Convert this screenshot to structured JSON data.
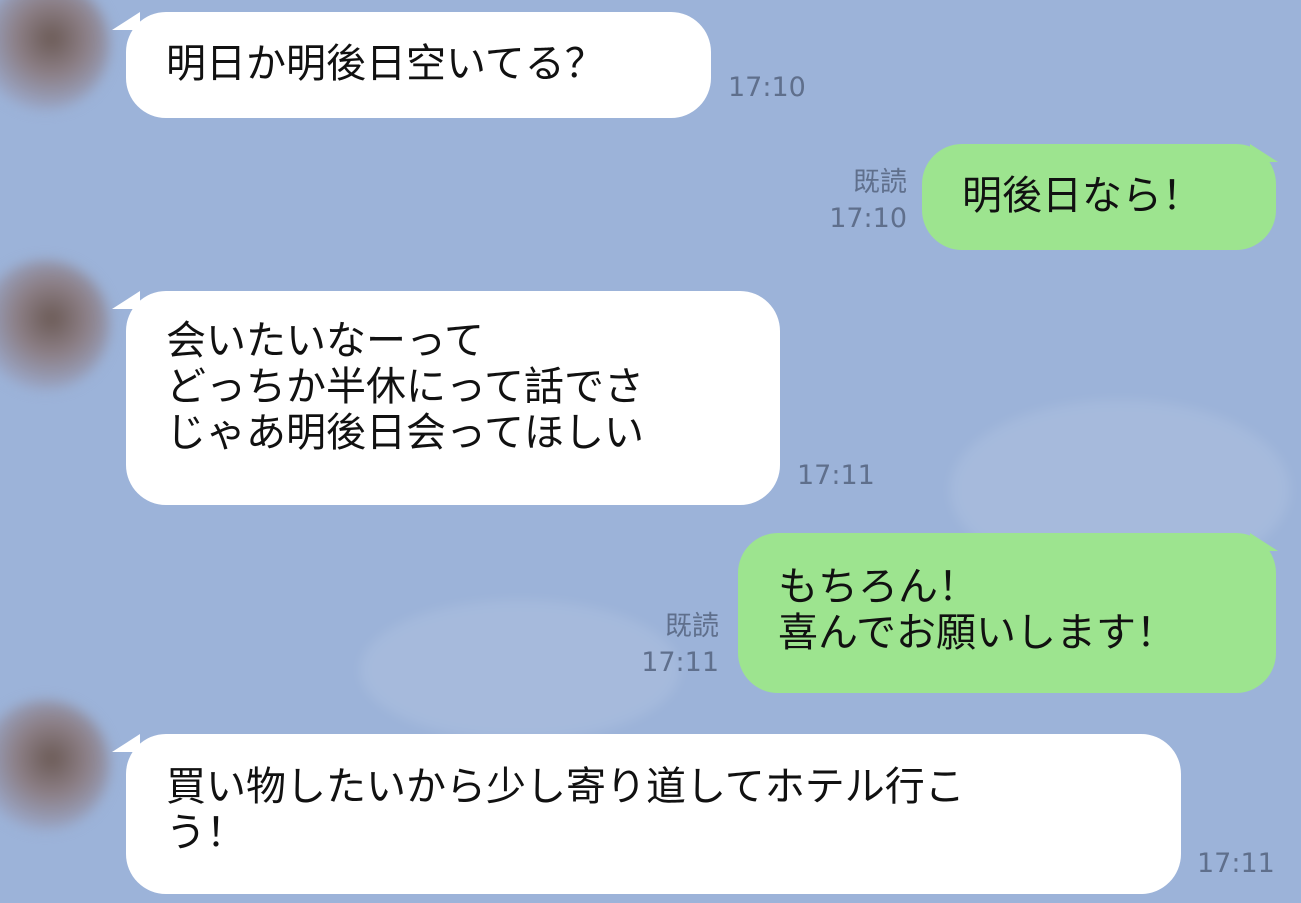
{
  "chat": {
    "messages": [
      {
        "direction": "incoming",
        "text": "明日か明後日空いてる？",
        "time": "17:10"
      },
      {
        "direction": "outgoing",
        "text": "明後日なら！",
        "read": "既読",
        "time": "17:10"
      },
      {
        "direction": "incoming",
        "text": "会いたいなーって\nどっちか半休にって話でさ\nじゃあ明後日会ってほしい",
        "time": "17:11"
      },
      {
        "direction": "outgoing",
        "text": "もちろん！\n喜んでお願いします！",
        "read": "既読",
        "time": "17:11"
      },
      {
        "direction": "incoming",
        "text": "買い物したいから少し寄り道してホテル行こ\nう！",
        "time": "17:11"
      }
    ]
  },
  "colors": {
    "background": "#9cb3d9",
    "incoming_bubble": "#ffffff",
    "outgoing_bubble": "#9de48f",
    "meta_text": "#5f6f8c"
  }
}
